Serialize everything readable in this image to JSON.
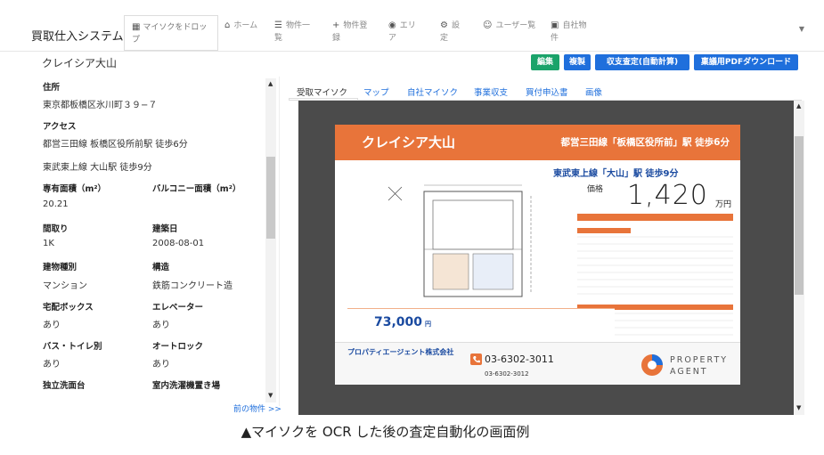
{
  "nav": {
    "brand": "買取仕入システム",
    "dropzone": "マイソクをドロップ",
    "items": [
      {
        "icon": "home-icon",
        "glyph": "⌂",
        "label": "ホーム"
      },
      {
        "icon": "list-icon",
        "glyph": "☰",
        "label": "物件一覧"
      },
      {
        "icon": "plus-icon",
        "glyph": "+",
        "label": "物件登録"
      },
      {
        "icon": "pin-icon",
        "glyph": "●",
        "label": "エリア"
      },
      {
        "icon": "gear-icon",
        "glyph": "⚙",
        "label": "設定"
      },
      {
        "icon": "users-icon",
        "glyph": "☺",
        "label": "ユーザー覧"
      },
      {
        "icon": "building-icon",
        "glyph": "▣",
        "label": "自社物件"
      }
    ]
  },
  "page": {
    "title": "クレイシア大山",
    "buttons": {
      "edit": "編集",
      "copy": "複製",
      "calc": "収支査定(自動計算)",
      "pdf": "稟議用PDFダウンロード"
    }
  },
  "details": {
    "address_label": "住所",
    "address": "東京都板橋区氷川町３９−７",
    "access_label": "アクセス",
    "access1": "都営三田線 板橋区役所前駅 徒歩6分",
    "access2": "東武東上線 大山駅 徒歩9分",
    "area_label": "専有面積（m²）",
    "area": "20.21",
    "balcony_label": "バルコニー面積（m²）",
    "layout_label": "間取り",
    "layout": "1K",
    "built_label": "建築日",
    "built": "2008-08-01",
    "type_label": "建物種別",
    "type": "マンション",
    "structure_label": "構造",
    "structure": "鉄筋コンクリート造",
    "delivery_label": "宅配ボックス",
    "delivery": "あり",
    "elevator_label": "エレベーター",
    "elevator": "あり",
    "bath_label": "バス・トイレ別",
    "bath": "あり",
    "autolock_label": "オートロック",
    "autolock": "あり",
    "vanity_label": "独立洗面台",
    "laundry_label": "室内洗濯機置き場",
    "next_link": "前の物件 >>"
  },
  "tabs": [
    "受取マイソク",
    "マップ",
    "自社マイソク",
    "事業収支",
    "買付申込書",
    "画像"
  ],
  "doc": {
    "name": "クレイシア大山",
    "line1": "都営三田線「板橋区役所前」駅 徒歩6分",
    "line2": "東武東上線「大山」駅 徒歩9分",
    "price_label": "価格",
    "price": "1,420",
    "price_unit": "万円",
    "rent": "73,000",
    "rent_unit": "円",
    "company": "プロパティエージェント株式会社",
    "phone": "03-6302-3011",
    "fax": "03-6302-3012",
    "logo": "PROPERTY\nAGENT"
  },
  "caption": "▲マイソクを OCR した後の査定自動化の画面例"
}
